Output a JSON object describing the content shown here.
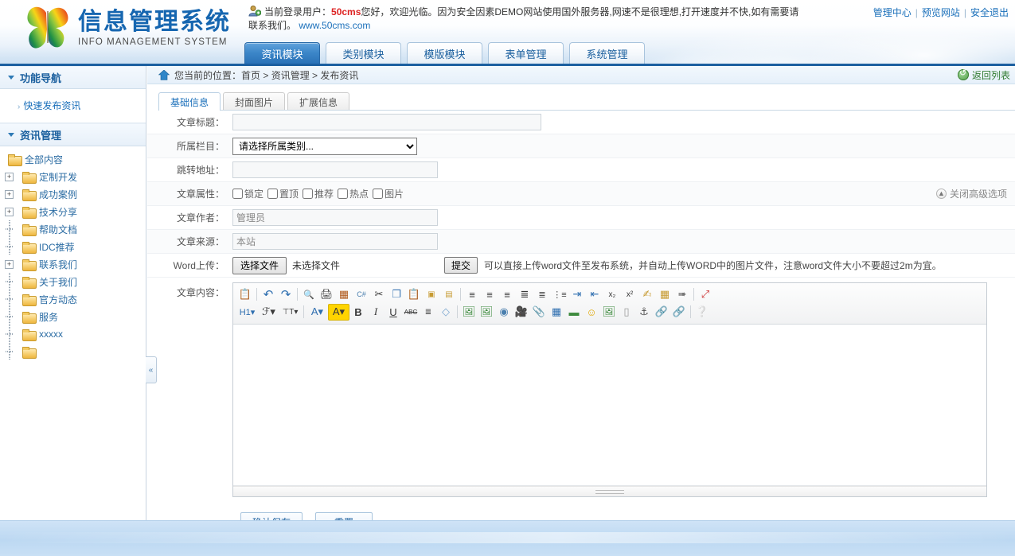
{
  "header": {
    "logo_cn": "信息管理系统",
    "logo_en": "INFO MANAGEMENT SYSTEM",
    "user_icon": "user-icon",
    "user_prefix": "当前登录用户：",
    "user_name": "50cms",
    "user_message": "您好，欢迎光临。因为安全因素DEMO网站使用国外服务器,网速不是很理想,打开速度并不快,如有需要请联系我们。",
    "site_url": "www.50cms.com",
    "links": [
      {
        "label": "管理中心"
      },
      {
        "label": "预览网站"
      },
      {
        "label": "安全退出"
      }
    ],
    "link_separator": "|"
  },
  "main_tabs": [
    {
      "label": "资讯模块",
      "active": true
    },
    {
      "label": "类别模块",
      "active": false
    },
    {
      "label": "模版模块",
      "active": false
    },
    {
      "label": "表单管理",
      "active": false
    },
    {
      "label": "系统管理",
      "active": false
    }
  ],
  "sidebar": {
    "nav_section_title": "功能导航",
    "quick_link": "快速发布资讯",
    "quick_link_arrow": "›",
    "tree_section_title": "资讯管理",
    "tree": [
      {
        "label": "全部内容",
        "expander": "none",
        "root": true
      },
      {
        "label": "定制开发",
        "expander": "plus"
      },
      {
        "label": "成功案例",
        "expander": "plus"
      },
      {
        "label": "技术分享",
        "expander": "plus"
      },
      {
        "label": "帮助文档",
        "expander": "none"
      },
      {
        "label": "IDC推荐",
        "expander": "none"
      },
      {
        "label": "联系我们",
        "expander": "plus"
      },
      {
        "label": "关于我们",
        "expander": "none"
      },
      {
        "label": "官方动态",
        "expander": "none"
      },
      {
        "label": "服务",
        "expander": "none"
      },
      {
        "label": "xxxxx",
        "expander": "none"
      },
      {
        "label": "",
        "expander": "none"
      }
    ],
    "collapse_icon": "«"
  },
  "breadcrumb": {
    "home_icon": "home-icon",
    "prefix": "您当前的位置：",
    "path": "首页 > 资讯管理 > 发布资讯",
    "back_label": "返回列表",
    "back_icon": "refresh-icon"
  },
  "form_tabs": [
    {
      "label": "基础信息",
      "active": true
    },
    {
      "label": "封面图片",
      "active": false
    },
    {
      "label": "扩展信息",
      "active": false
    }
  ],
  "form": {
    "title_label": "文章标题：",
    "title_value": "",
    "title_placeholder": "",
    "category_label": "所属栏目：",
    "category_selected": "请选择所属类别...",
    "category_options": [
      "请选择所属类别..."
    ],
    "jump_label": "跳转地址：",
    "jump_value": "",
    "attrs_label": "文章属性：",
    "attrs": [
      {
        "label": "锁定",
        "checked": false
      },
      {
        "label": "置顶",
        "checked": false
      },
      {
        "label": "推荐",
        "checked": false
      },
      {
        "label": "热点",
        "checked": false
      },
      {
        "label": "图片",
        "checked": false
      }
    ],
    "advanced_toggle": "关闭高级选项",
    "advanced_icon": "chevron-up-circle-icon",
    "author_label": "文章作者：",
    "author_value": "管理员",
    "source_label": "文章来源：",
    "source_value": "本站",
    "word_label": "Word上传：",
    "choose_file_button": "选择文件",
    "no_file_text": "未选择文件",
    "submit_button": "提交",
    "word_hint": "可以直接上传word文件至发布系统，并自动上传WORD中的图片文件，注意word文件大小不要超过2m为宜。",
    "content_label": "文章内容："
  },
  "editor": {
    "toolbar_row1": [
      {
        "icon": "paste-clipboard-icon",
        "glyph": "ὌB",
        "char": "▤"
      },
      {
        "sep": true
      },
      {
        "icon": "undo-icon",
        "char": "↶"
      },
      {
        "icon": "redo-icon",
        "char": "↷"
      },
      {
        "sep": true
      },
      {
        "icon": "print-preview-icon",
        "char": "🔍"
      },
      {
        "icon": "print-icon",
        "char": "🖨"
      },
      {
        "icon": "source-code-icon",
        "char": "▤"
      },
      {
        "icon": "csharp-code-icon",
        "char": "C#"
      },
      {
        "icon": "cut-icon",
        "char": "✂"
      },
      {
        "icon": "copy-icon",
        "char": "❐"
      },
      {
        "icon": "paste-icon",
        "char": "📋"
      },
      {
        "icon": "paste-text-icon",
        "char": "T"
      },
      {
        "icon": "paste-word-icon",
        "char": "W"
      },
      {
        "sep": true
      },
      {
        "icon": "align-left-icon",
        "char": "≡"
      },
      {
        "icon": "align-center-icon",
        "char": "≡"
      },
      {
        "icon": "align-right-icon",
        "char": "≡"
      },
      {
        "icon": "align-justify-icon",
        "char": "≡"
      },
      {
        "icon": "ordered-list-icon",
        "char": "≔"
      },
      {
        "icon": "unordered-list-icon",
        "char": "≔"
      },
      {
        "icon": "indent-increase-icon",
        "char": "⇥"
      },
      {
        "icon": "indent-decrease-icon",
        "char": "⇤"
      },
      {
        "icon": "subscript-icon",
        "char": "x₂"
      },
      {
        "icon": "superscript-icon",
        "char": "x²"
      },
      {
        "icon": "format-brush-icon",
        "char": "🖌"
      },
      {
        "icon": "remove-format-icon",
        "char": "▤"
      },
      {
        "icon": "select-pointer-icon",
        "char": "↖"
      },
      {
        "sep": true
      },
      {
        "icon": "fullscreen-icon",
        "char": "⤢"
      }
    ],
    "toolbar_row2": [
      {
        "icon": "heading-style-icon",
        "char": "H1"
      },
      {
        "icon": "font-family-icon",
        "char": "F"
      },
      {
        "icon": "font-size-icon",
        "char": "T"
      },
      {
        "sep": true
      },
      {
        "icon": "font-color-icon",
        "char": "A"
      },
      {
        "icon": "highlight-color-icon",
        "char": "A"
      },
      {
        "icon": "bold-icon",
        "char": "B"
      },
      {
        "icon": "italic-icon",
        "char": "I"
      },
      {
        "icon": "underline-icon",
        "char": "U"
      },
      {
        "icon": "strikethrough-icon",
        "char": "ABC"
      },
      {
        "icon": "line-height-icon",
        "char": "⇕"
      },
      {
        "icon": "eraser-icon",
        "char": "◻"
      },
      {
        "sep": true
      },
      {
        "icon": "insert-image-icon",
        "char": "🖼"
      },
      {
        "icon": "batch-image-icon",
        "char": "🖼"
      },
      {
        "icon": "flash-icon",
        "char": "◍"
      },
      {
        "icon": "video-icon",
        "char": "🎥"
      },
      {
        "icon": "attachment-icon",
        "char": "📎"
      },
      {
        "icon": "table-icon",
        "char": "▦"
      },
      {
        "icon": "insert-row-icon",
        "char": "▭"
      },
      {
        "icon": "emoticon-icon",
        "char": "☺"
      },
      {
        "icon": "background-image-icon",
        "char": "🖼"
      },
      {
        "icon": "page-break-icon",
        "char": "▭"
      },
      {
        "icon": "anchor-icon",
        "char": "⚓"
      },
      {
        "icon": "link-icon",
        "char": "🔗"
      },
      {
        "icon": "unlink-icon",
        "char": "🔗"
      },
      {
        "sep": true
      },
      {
        "icon": "help-icon",
        "char": "?"
      }
    ],
    "content_value": ""
  },
  "actions": {
    "save_label": "确认保存",
    "reset_label": "重置"
  }
}
